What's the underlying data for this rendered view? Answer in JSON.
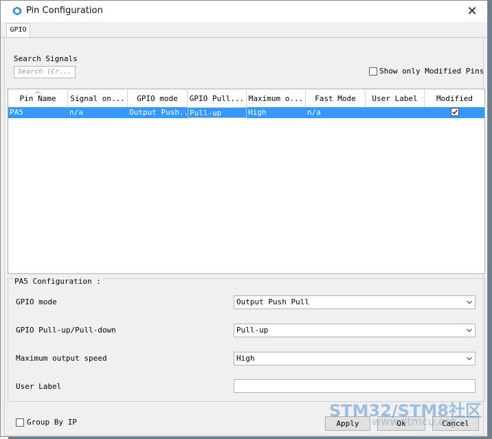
{
  "window": {
    "title": "Pin Configuration"
  },
  "tabs": [
    {
      "label": "GPIO",
      "active": true
    }
  ],
  "search": {
    "label": "Search Signals",
    "placeholder": "Search (Cr..."
  },
  "filter": {
    "show_modified_label": "Show only Modified Pins",
    "checked": false
  },
  "table": {
    "columns": [
      "Pin Name",
      "Signal on...",
      "GPIO mode",
      "GPIO Pull...",
      "Maximum o...",
      "Fast Mode",
      "User Label",
      "Modified"
    ],
    "sorted_column": "Pin Name",
    "rows": [
      {
        "pin": "PA5",
        "signal": "n/a",
        "gpio_mode": "Output Push...",
        "pull": "Pull-up",
        "speed": "High",
        "fast_mode": "n/a",
        "user_label": "",
        "modified": true
      }
    ]
  },
  "config": {
    "title": "PA5 Configuration :",
    "gpio_mode_label": "GPIO mode",
    "gpio_mode_value": "Output Push Pull",
    "pull_label": "GPIO Pull-up/Pull-down",
    "pull_value": "Pull-up",
    "speed_label": "Maximum output speed",
    "speed_value": "High",
    "user_label_label": "User Label",
    "user_label_value": ""
  },
  "footer": {
    "group_by_label": "Group By IP",
    "group_by_checked": false,
    "apply": "Apply",
    "ok": "Ok",
    "cancel": "Cancel"
  },
  "watermark": {
    "text": "STM32/STM8社区",
    "sub": "www.stmcu.org"
  },
  "colors": {
    "selection": "#3399ff",
    "dialog_bg": "#f0f0f0",
    "title_icon": "#3c8fd6"
  }
}
